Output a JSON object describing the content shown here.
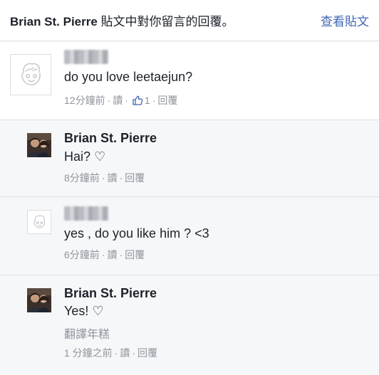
{
  "header": {
    "author": "Brian St. Pierre",
    "title_suffix": " 貼文中對你留言的回覆。",
    "view_post": "查看貼文"
  },
  "comments": [
    {
      "author": "",
      "text": "do you love leetaejun?",
      "time": "12分鐘前",
      "action_like": "讀",
      "like_count": "1",
      "action_reply": "回覆"
    },
    {
      "author": "Brian St. Pierre",
      "text": "Hai? ♡",
      "time": "8分鐘前",
      "action_like": "讀",
      "action_reply": "回覆"
    },
    {
      "author": "",
      "text": "yes , do you like him ? <3",
      "time": "6分鐘前",
      "action_like": "讀",
      "action_reply": "回覆"
    },
    {
      "author": "Brian St. Pierre",
      "text": "Yes! ♡",
      "translate": "翻譯年糕",
      "time": "1 分鐘之前",
      "action_like": "讀",
      "action_reply": "回覆"
    }
  ],
  "colors": {
    "link": "#4267b2",
    "meta": "#90949c",
    "reply_bg": "#f6f7f9"
  },
  "icons": [
    "default-avatar-icon",
    "profile-photo-icon",
    "thumbs-up-icon"
  ]
}
